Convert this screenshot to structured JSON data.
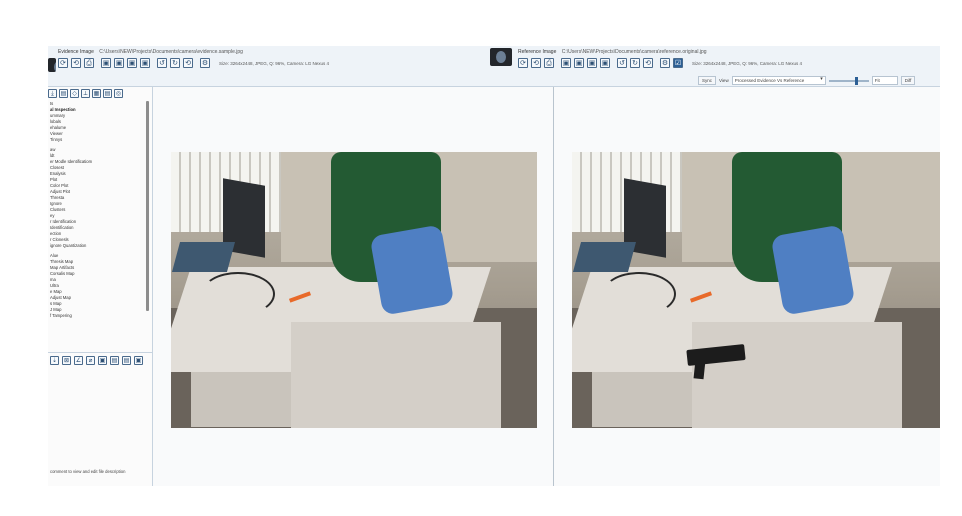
{
  "left_panel": {
    "label": "Evidence Image",
    "path": "C:\\Users\\NEW\\Projects\\Documents\\camera\\evidence.sample.jpg",
    "meta": "Size: 3264x2448, JPEG, Q: 96%, Camera: LG Nexus 4",
    "toolbar_glyphs": [
      "⟳",
      "⟲",
      "⎙",
      "▣",
      "▣",
      "▣",
      "▣",
      "↺",
      "↻",
      "⟲",
      "⚙"
    ]
  },
  "right_panel": {
    "label": "Reference Image",
    "path": "C:\\Users\\NEW\\Projects\\Documents\\camera\\reference.original.jpg",
    "meta": "Size: 3264x2448, JPEG, Q: 96%, Camera: LG Nexus 4",
    "toolbar_glyphs": [
      "⟳",
      "⟲",
      "⎙",
      "▣",
      "▣",
      "▣",
      "▣",
      "↺",
      "↻",
      "⟲",
      "⚙",
      "☑"
    ]
  },
  "view_bar": {
    "sync_label": "Sync",
    "view_label": "View",
    "view_value": "Processed Evidence Vs Reference",
    "zoom_value": "Fit",
    "reset_label": "Diff"
  },
  "sidebar": {
    "tool_glyphs": [
      "⤓",
      "▤",
      "◇",
      "⟂",
      "▦",
      "▤",
      "◎"
    ],
    "items": [
      "ts",
      "al Inspection",
      "ummary",
      "lobals",
      "ehalume",
      "Viewer",
      "Tinnys",
      "",
      "aw",
      "ldt",
      "er Modle Identificatiom",
      "Closest",
      "Enalysis",
      "Plot",
      "Color Plot",
      "Adjust Plot",
      "Thresta",
      "Ignore",
      "Clusters",
      "ey",
      "r Identification",
      "Identification",
      "ection",
      "r Clonesls",
      "ignore Quantization",
      "",
      "Alue",
      "Thresis Map",
      "Map Artifacts",
      "Corsalis Map",
      "ma",
      "Ultra",
      "e Map",
      "Adjust Map",
      "s Map",
      "J Map",
      "f Tampering"
    ],
    "bottom_glyphs": [
      "⇣",
      "⊠",
      "∠",
      "⌀",
      "▣",
      "▤",
      "▤",
      "▣"
    ],
    "description": "comment to view and edit file description"
  }
}
